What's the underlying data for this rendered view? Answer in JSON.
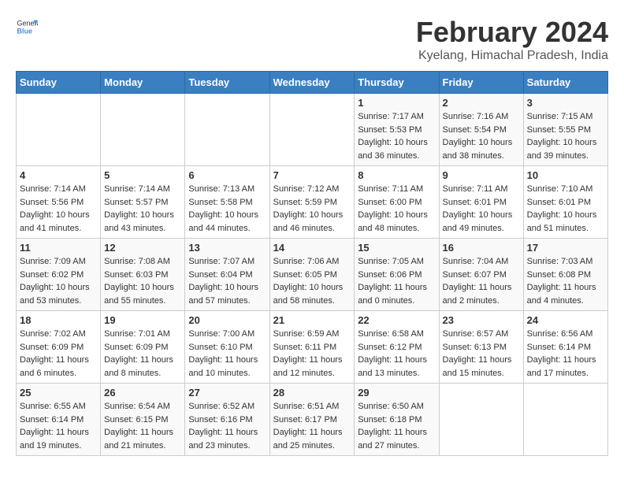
{
  "logo": {
    "general": "General",
    "blue": "Blue"
  },
  "title": {
    "month": "February 2024",
    "location": "Kyelang, Himachal Pradesh, India"
  },
  "headers": [
    "Sunday",
    "Monday",
    "Tuesday",
    "Wednesday",
    "Thursday",
    "Friday",
    "Saturday"
  ],
  "weeks": [
    [
      {
        "day": "",
        "info": ""
      },
      {
        "day": "",
        "info": ""
      },
      {
        "day": "",
        "info": ""
      },
      {
        "day": "",
        "info": ""
      },
      {
        "day": "1",
        "info": "Sunrise: 7:17 AM\nSunset: 5:53 PM\nDaylight: 10 hours\nand 36 minutes."
      },
      {
        "day": "2",
        "info": "Sunrise: 7:16 AM\nSunset: 5:54 PM\nDaylight: 10 hours\nand 38 minutes."
      },
      {
        "day": "3",
        "info": "Sunrise: 7:15 AM\nSunset: 5:55 PM\nDaylight: 10 hours\nand 39 minutes."
      }
    ],
    [
      {
        "day": "4",
        "info": "Sunrise: 7:14 AM\nSunset: 5:56 PM\nDaylight: 10 hours\nand 41 minutes."
      },
      {
        "day": "5",
        "info": "Sunrise: 7:14 AM\nSunset: 5:57 PM\nDaylight: 10 hours\nand 43 minutes."
      },
      {
        "day": "6",
        "info": "Sunrise: 7:13 AM\nSunset: 5:58 PM\nDaylight: 10 hours\nand 44 minutes."
      },
      {
        "day": "7",
        "info": "Sunrise: 7:12 AM\nSunset: 5:59 PM\nDaylight: 10 hours\nand 46 minutes."
      },
      {
        "day": "8",
        "info": "Sunrise: 7:11 AM\nSunset: 6:00 PM\nDaylight: 10 hours\nand 48 minutes."
      },
      {
        "day": "9",
        "info": "Sunrise: 7:11 AM\nSunset: 6:01 PM\nDaylight: 10 hours\nand 49 minutes."
      },
      {
        "day": "10",
        "info": "Sunrise: 7:10 AM\nSunset: 6:01 PM\nDaylight: 10 hours\nand 51 minutes."
      }
    ],
    [
      {
        "day": "11",
        "info": "Sunrise: 7:09 AM\nSunset: 6:02 PM\nDaylight: 10 hours\nand 53 minutes."
      },
      {
        "day": "12",
        "info": "Sunrise: 7:08 AM\nSunset: 6:03 PM\nDaylight: 10 hours\nand 55 minutes."
      },
      {
        "day": "13",
        "info": "Sunrise: 7:07 AM\nSunset: 6:04 PM\nDaylight: 10 hours\nand 57 minutes."
      },
      {
        "day": "14",
        "info": "Sunrise: 7:06 AM\nSunset: 6:05 PM\nDaylight: 10 hours\nand 58 minutes."
      },
      {
        "day": "15",
        "info": "Sunrise: 7:05 AM\nSunset: 6:06 PM\nDaylight: 11 hours\nand 0 minutes."
      },
      {
        "day": "16",
        "info": "Sunrise: 7:04 AM\nSunset: 6:07 PM\nDaylight: 11 hours\nand 2 minutes."
      },
      {
        "day": "17",
        "info": "Sunrise: 7:03 AM\nSunset: 6:08 PM\nDaylight: 11 hours\nand 4 minutes."
      }
    ],
    [
      {
        "day": "18",
        "info": "Sunrise: 7:02 AM\nSunset: 6:09 PM\nDaylight: 11 hours\nand 6 minutes."
      },
      {
        "day": "19",
        "info": "Sunrise: 7:01 AM\nSunset: 6:09 PM\nDaylight: 11 hours\nand 8 minutes."
      },
      {
        "day": "20",
        "info": "Sunrise: 7:00 AM\nSunset: 6:10 PM\nDaylight: 11 hours\nand 10 minutes."
      },
      {
        "day": "21",
        "info": "Sunrise: 6:59 AM\nSunset: 6:11 PM\nDaylight: 11 hours\nand 12 minutes."
      },
      {
        "day": "22",
        "info": "Sunrise: 6:58 AM\nSunset: 6:12 PM\nDaylight: 11 hours\nand 13 minutes."
      },
      {
        "day": "23",
        "info": "Sunrise: 6:57 AM\nSunset: 6:13 PM\nDaylight: 11 hours\nand 15 minutes."
      },
      {
        "day": "24",
        "info": "Sunrise: 6:56 AM\nSunset: 6:14 PM\nDaylight: 11 hours\nand 17 minutes."
      }
    ],
    [
      {
        "day": "25",
        "info": "Sunrise: 6:55 AM\nSunset: 6:14 PM\nDaylight: 11 hours\nand 19 minutes."
      },
      {
        "day": "26",
        "info": "Sunrise: 6:54 AM\nSunset: 6:15 PM\nDaylight: 11 hours\nand 21 minutes."
      },
      {
        "day": "27",
        "info": "Sunrise: 6:52 AM\nSunset: 6:16 PM\nDaylight: 11 hours\nand 23 minutes."
      },
      {
        "day": "28",
        "info": "Sunrise: 6:51 AM\nSunset: 6:17 PM\nDaylight: 11 hours\nand 25 minutes."
      },
      {
        "day": "29",
        "info": "Sunrise: 6:50 AM\nSunset: 6:18 PM\nDaylight: 11 hours\nand 27 minutes."
      },
      {
        "day": "",
        "info": ""
      },
      {
        "day": "",
        "info": ""
      }
    ]
  ]
}
